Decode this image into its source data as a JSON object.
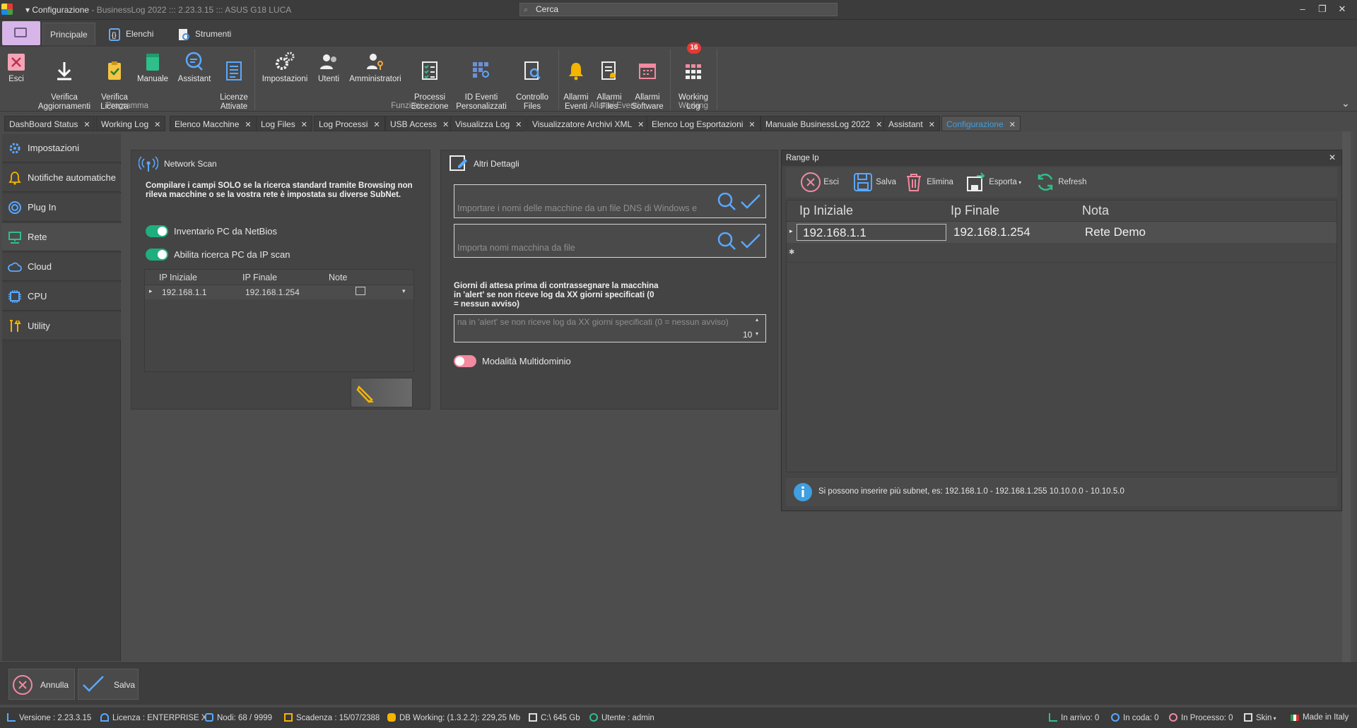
{
  "window": {
    "title": "Configurazione",
    "subtitle": "- BusinessLog 2022 ::: 2.23.3.15 ::: ASUS G18 LUCA",
    "search_placeholder": "Cerca",
    "controls": [
      "–",
      "❐",
      "✕"
    ]
  },
  "ribbon_tabs": [
    {
      "label": "Principale",
      "active": true
    },
    {
      "label": "Elenchi",
      "active": false
    },
    {
      "label": "Strumenti",
      "active": false
    }
  ],
  "ribbon": {
    "groups": [
      {
        "label": "Programma"
      },
      {
        "label": "Funzioni"
      },
      {
        "label": "Allarmi Eventi"
      },
      {
        "label": "Working"
      }
    ],
    "buttons": [
      {
        "label": "Esci",
        "icon": "close-x-icon"
      },
      {
        "label": "Verifica\nAggiornamenti",
        "icon": "download-icon"
      },
      {
        "label": "Verifica\nLicenza",
        "icon": "clipboard-check-icon"
      },
      {
        "label": "Manuale",
        "icon": "book-icon"
      },
      {
        "label": "Assistant",
        "icon": "chat-icon"
      },
      {
        "label": "Licenze\nAttivate",
        "icon": "license-list-icon"
      },
      {
        "label": "Impostazioni",
        "icon": "gears-icon"
      },
      {
        "label": "Utenti",
        "icon": "users-icon"
      },
      {
        "label": "Amministratori",
        "icon": "admin-key-icon"
      },
      {
        "label": "Processi\nEccezione",
        "icon": "checklist-icon"
      },
      {
        "label": "ID Eventi\nPersonalizzati",
        "icon": "grid-search-icon"
      },
      {
        "label": "Controllo\nFiles",
        "icon": "file-search-icon"
      },
      {
        "label": "Allarmi\nEventi",
        "icon": "bell-icon"
      },
      {
        "label": "Allarmi\nFiles",
        "icon": "file-alarm-icon"
      },
      {
        "label": "Allarmi\nSoftware",
        "icon": "calendar-alarm-icon"
      },
      {
        "label": "Working\nLog",
        "icon": "working-log-icon",
        "badge": "16"
      }
    ]
  },
  "doc_tabs": [
    {
      "label": "DashBoard Status"
    },
    {
      "label": "Working Log"
    },
    {
      "label": "Elenco Macchine"
    },
    {
      "label": "Log Files"
    },
    {
      "label": "Log Processi"
    },
    {
      "label": "USB Access"
    },
    {
      "label": "Visualizza Log"
    },
    {
      "label": "Visualizzatore Archivi XML"
    },
    {
      "label": "Elenco Log Esportazioni"
    },
    {
      "label": "Manuale BusinessLog 2022"
    },
    {
      "label": "Assistant"
    },
    {
      "label": "Configurazione",
      "active": true
    }
  ],
  "nav": [
    {
      "label": "Impostazioni",
      "icon": "gear-icon"
    },
    {
      "label": "Notifiche automatiche",
      "icon": "bell-icon"
    },
    {
      "label": "Plug In",
      "icon": "plug-icon"
    },
    {
      "label": "Rete",
      "icon": "network-icon",
      "active": true
    },
    {
      "label": "Cloud",
      "icon": "cloud-icon"
    },
    {
      "label": "CPU",
      "icon": "cpu-icon"
    },
    {
      "label": "Utility",
      "icon": "tools-icon"
    }
  ],
  "network_scan": {
    "title": "Network Scan",
    "note": "Compilare i campi SOLO se la ricerca standard tramite Browsing non rileva macchine o se la vostra rete è impostata su diverse SubNet.",
    "toggle1": "Inventario PC da NetBios",
    "toggle2": "Abilita ricerca PC da IP scan",
    "grid_headers": [
      "IP Iniziale",
      "IP Finale",
      "Note"
    ],
    "grid_rows": [
      [
        "192.168.1.1",
        "192.168.1.254",
        ""
      ]
    ]
  },
  "altri_dettagli": {
    "title": "Altri Dettagli",
    "dns_placeholder": "Importare i nomi delle macchine da un file DNS di Windows e",
    "file_placeholder": "Importa nomi macchina da file",
    "wait_label": "Giorni di attesa prima di contrassegnare la macchina in 'alert' se non riceve log da XX giorni specificati (0 = nessun avviso)",
    "wait_placeholder": "na in 'alert' se non riceve log da XX giorni specificati (0 = nessun avviso)",
    "wait_value": "10",
    "multidomain_label": "Modalità Multidominio"
  },
  "range_ip": {
    "title": "Range Ip",
    "toolbar": [
      "Esci",
      "Salva",
      "Elimina",
      "Esporta",
      "Refresh"
    ],
    "headers": [
      "Ip Iniziale",
      "Ip Finale",
      "Nota"
    ],
    "rows": [
      [
        "192.168.1.1",
        "192.168.1.254",
        "Rete Demo"
      ]
    ],
    "info": "Si possono inserire più subnet, es: 192.168.1.0 - 192.168.1.255 10.10.0.0 - 10.10.5.0"
  },
  "bottom": {
    "cancel": "Annulla",
    "save": "Salva"
  },
  "status": {
    "version": "Versione : 2.23.3.15",
    "license": "Licenza : ENTERPRISE X",
    "nodes": "Nodi: 68 / 9999",
    "expiry": "Scadenza : 15/07/2388",
    "db": "DB Working: (1.3.2.2): 229,25 Mb",
    "disk": "C:\\ 645 Gb",
    "user": "Utente : admin",
    "incoming": "In arrivo: 0",
    "queue": "In coda: 0",
    "processing": "In Processo: 0",
    "skin": "Skin",
    "made": "Made in Italy"
  },
  "colors": {
    "accent": "#3f9fe0",
    "toggle_on": "#1fae7e",
    "toggle_off": "#f28aa0",
    "badge": "#e53935"
  }
}
